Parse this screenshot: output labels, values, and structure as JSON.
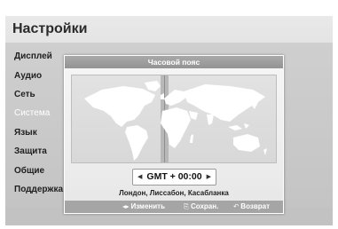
{
  "screen": {
    "title": "Настройки"
  },
  "menu": {
    "items": [
      {
        "label": "Дисплей"
      },
      {
        "label": "Аудио"
      },
      {
        "label": "Сеть"
      },
      {
        "label": "Система",
        "selected": true
      },
      {
        "label": "Язык"
      },
      {
        "label": "Защита"
      },
      {
        "label": "Общие"
      },
      {
        "label": "Поддержка"
      }
    ]
  },
  "dialog": {
    "title": "Часовой пояс",
    "timezone": {
      "value": "GMT + 00:00",
      "cities": "Лондон, Лиссабон, Касабланка",
      "left_icon": "arrow-left-icon",
      "right_icon": "arrow-right-icon"
    },
    "footer": {
      "change": {
        "icon": "◂▸",
        "icon_name": "left-right-arrows-icon",
        "label": "Изменить"
      },
      "save": {
        "icon": "⎘",
        "icon_name": "enter-key-icon",
        "label": "Сохран."
      },
      "back": {
        "icon": "↶",
        "icon_name": "return-arrow-icon",
        "label": "Возврат"
      }
    }
  },
  "colors": {
    "background": "#dcdcdc",
    "dialog_header": "#9e9e9e",
    "selected_item_text": "#ffffff",
    "map_land": "#ffffff"
  }
}
